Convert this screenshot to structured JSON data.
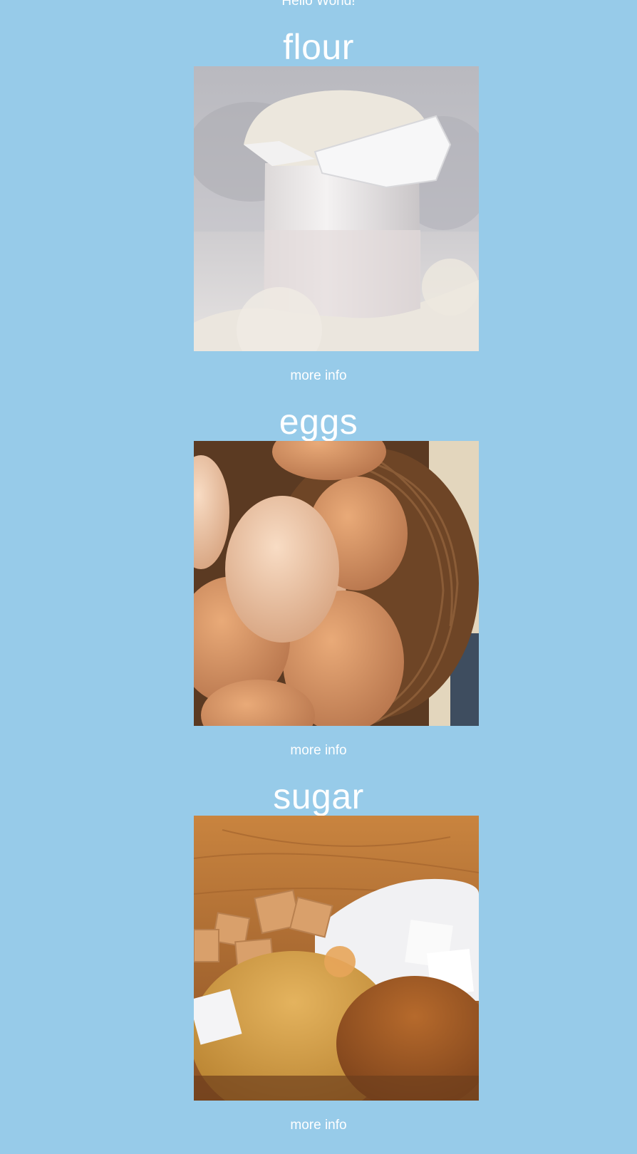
{
  "header": {
    "greeting": "Hello World!"
  },
  "items": [
    {
      "title": "flour",
      "image_alt": "flour",
      "link_label": "more info"
    },
    {
      "title": "eggs",
      "image_alt": "eggs",
      "link_label": "more info"
    },
    {
      "title": "sugar",
      "image_alt": "sugar",
      "link_label": "more info"
    }
  ]
}
